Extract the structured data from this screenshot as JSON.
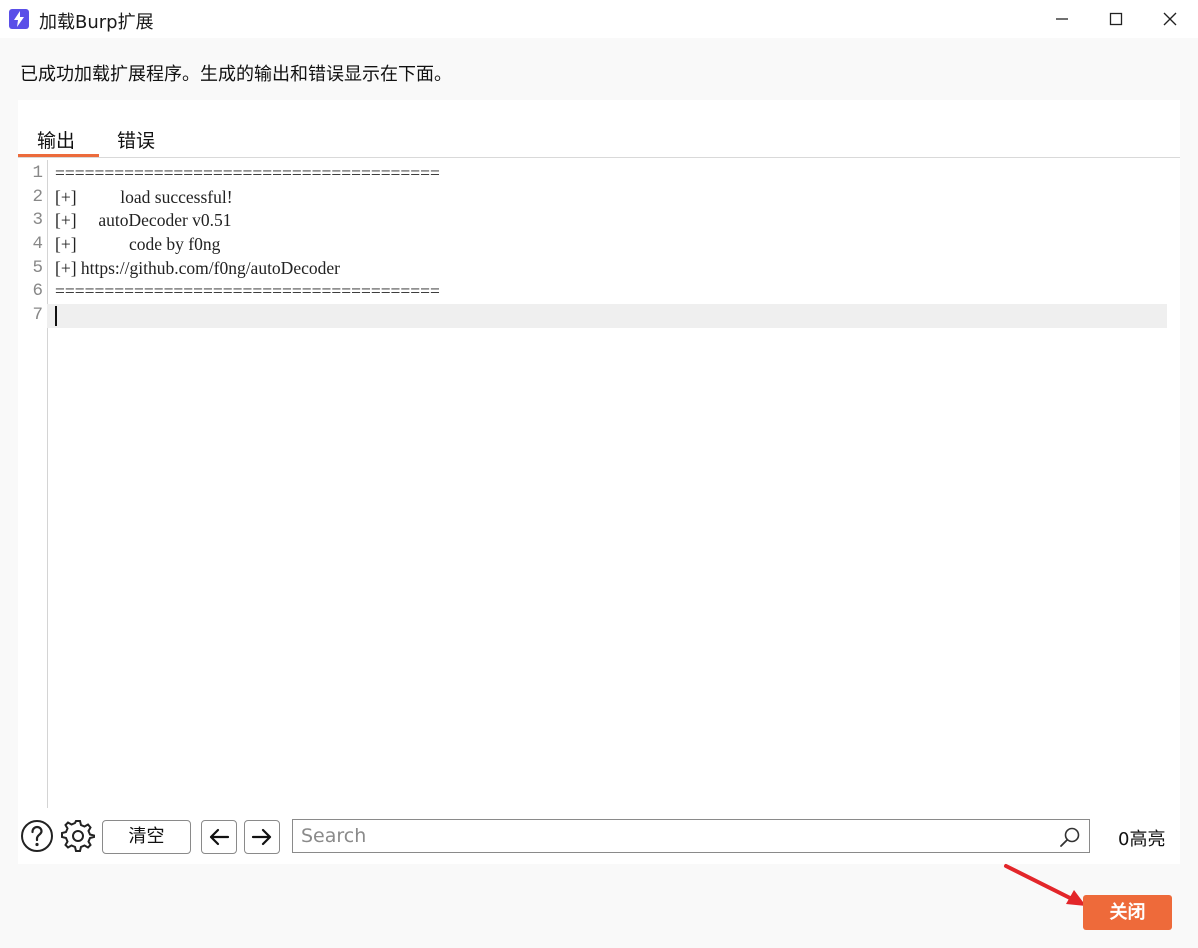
{
  "window": {
    "title": "加载Burp扩展"
  },
  "message": "已成功加载扩展程序。生成的输出和错误显示在下面。",
  "tabs": [
    {
      "label": "输出",
      "selected": true
    },
    {
      "label": "错误",
      "selected": false
    }
  ],
  "editor": {
    "lines": [
      {
        "num": "1",
        "text": "======================================="
      },
      {
        "num": "2",
        "text": "[+]          load successful!"
      },
      {
        "num": "3",
        "text": "[+]     autoDecoder v0.51"
      },
      {
        "num": "4",
        "text": "[+]            code by f0ng"
      },
      {
        "num": "5",
        "text": "[+] https://github.com/f0ng/autoDecoder"
      },
      {
        "num": "6",
        "text": "======================================="
      },
      {
        "num": "7",
        "text": ""
      }
    ]
  },
  "toolbar": {
    "clear_label": "清空",
    "search_placeholder": "Search",
    "highlight_count": "0高亮"
  },
  "footer": {
    "close_label": "关闭"
  },
  "colors": {
    "accent": "#ec6b3c",
    "close_button": "#ee6a3a",
    "annotation_arrow": "#e3262a",
    "app_icon": "#5a4fe8"
  },
  "icons": [
    "burp-extension-icon",
    "minimize-icon",
    "maximize-icon",
    "close-icon",
    "help-icon",
    "gear-icon",
    "arrow-left-icon",
    "arrow-right-icon",
    "search-icon"
  ]
}
